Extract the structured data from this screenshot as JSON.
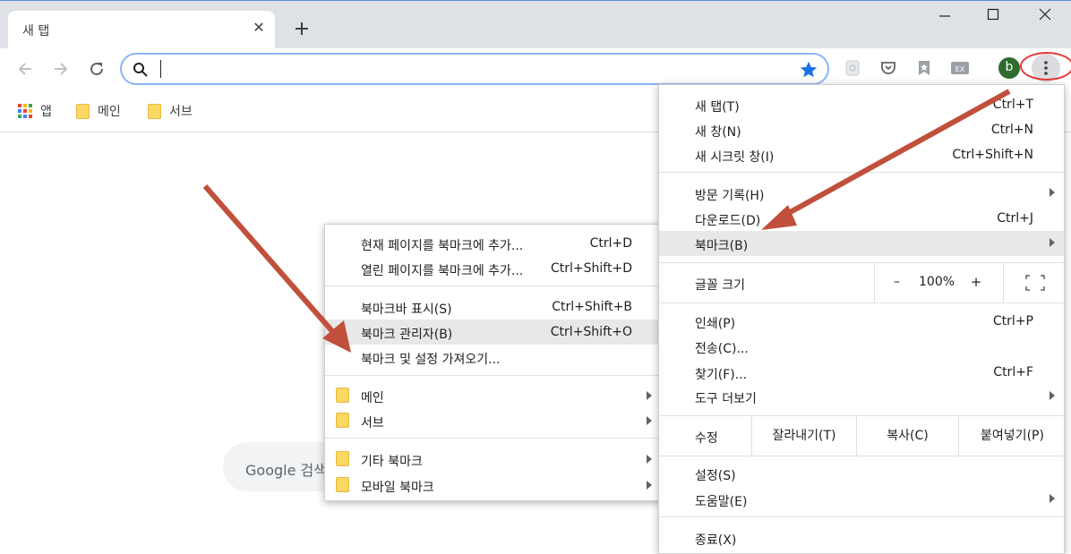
{
  "tab": {
    "title": "새 탭",
    "close_glyph": "✕"
  },
  "window_controls": {
    "minimize": "—",
    "maximize": "☐",
    "close": "✕"
  },
  "omnibox": {
    "value": "",
    "placeholder": ""
  },
  "avatar": {
    "letter": "b",
    "color": "#2e6b2f"
  },
  "bookmarks_bar": {
    "apps_label": "앱",
    "items": [
      {
        "label": "메인",
        "icon": "folder-icon"
      },
      {
        "label": "서브",
        "icon": "folder-icon"
      }
    ]
  },
  "google_search": {
    "placeholder": "Google 검색"
  },
  "main_menu": {
    "items": [
      {
        "label": "새 탭(T)",
        "shortcut": "Ctrl+T"
      },
      {
        "label": "새 창(N)",
        "shortcut": "Ctrl+N"
      },
      {
        "label": "새 시크릿 창(I)",
        "shortcut": "Ctrl+Shift+N"
      },
      {
        "label": "방문 기록(H)",
        "shortcut": ""
      },
      {
        "label": "다운로드(D)",
        "shortcut": "Ctrl+J"
      },
      {
        "label": "북마크(B)",
        "shortcut": ""
      },
      {
        "label": "인쇄(P)",
        "shortcut": "Ctrl+P"
      },
      {
        "label": "전송(C)...",
        "shortcut": ""
      },
      {
        "label": "찾기(F)...",
        "shortcut": "Ctrl+F"
      },
      {
        "label": "도구 더보기",
        "shortcut": ""
      },
      {
        "label": "설정(S)",
        "shortcut": ""
      },
      {
        "label": "도움말(E)",
        "shortcut": ""
      },
      {
        "label": "종료(X)",
        "shortcut": ""
      }
    ],
    "zoom": {
      "label": "글꼴 크기",
      "minus": "–",
      "value": "100%",
      "plus": "+"
    },
    "edit": {
      "label": "수정",
      "cut": "잘라내기(T)",
      "copy": "복사(C)",
      "paste": "붙여넣기(P)"
    }
  },
  "bookmark_submenu": {
    "items": [
      {
        "label": "현재 페이지를 북마크에 추가...",
        "shortcut": "Ctrl+D"
      },
      {
        "label": "열린 페이지를 북마크에 추가...",
        "shortcut": "Ctrl+Shift+D"
      },
      {
        "label": "북마크바 표시(S)",
        "shortcut": "Ctrl+Shift+B"
      },
      {
        "label": "북마크 관리자(B)",
        "shortcut": "Ctrl+Shift+O"
      },
      {
        "label": "북마크 및 설정 가져오기...",
        "shortcut": ""
      }
    ],
    "folders": [
      {
        "label": "메인"
      },
      {
        "label": "서브"
      },
      {
        "label": "기타 북마크"
      },
      {
        "label": "모바일 북마크"
      }
    ]
  },
  "colors": {
    "accent": "#1a73e8",
    "annotation": "#c0503c",
    "highlight_circle": "#e53935",
    "folder": "#fbd864"
  }
}
